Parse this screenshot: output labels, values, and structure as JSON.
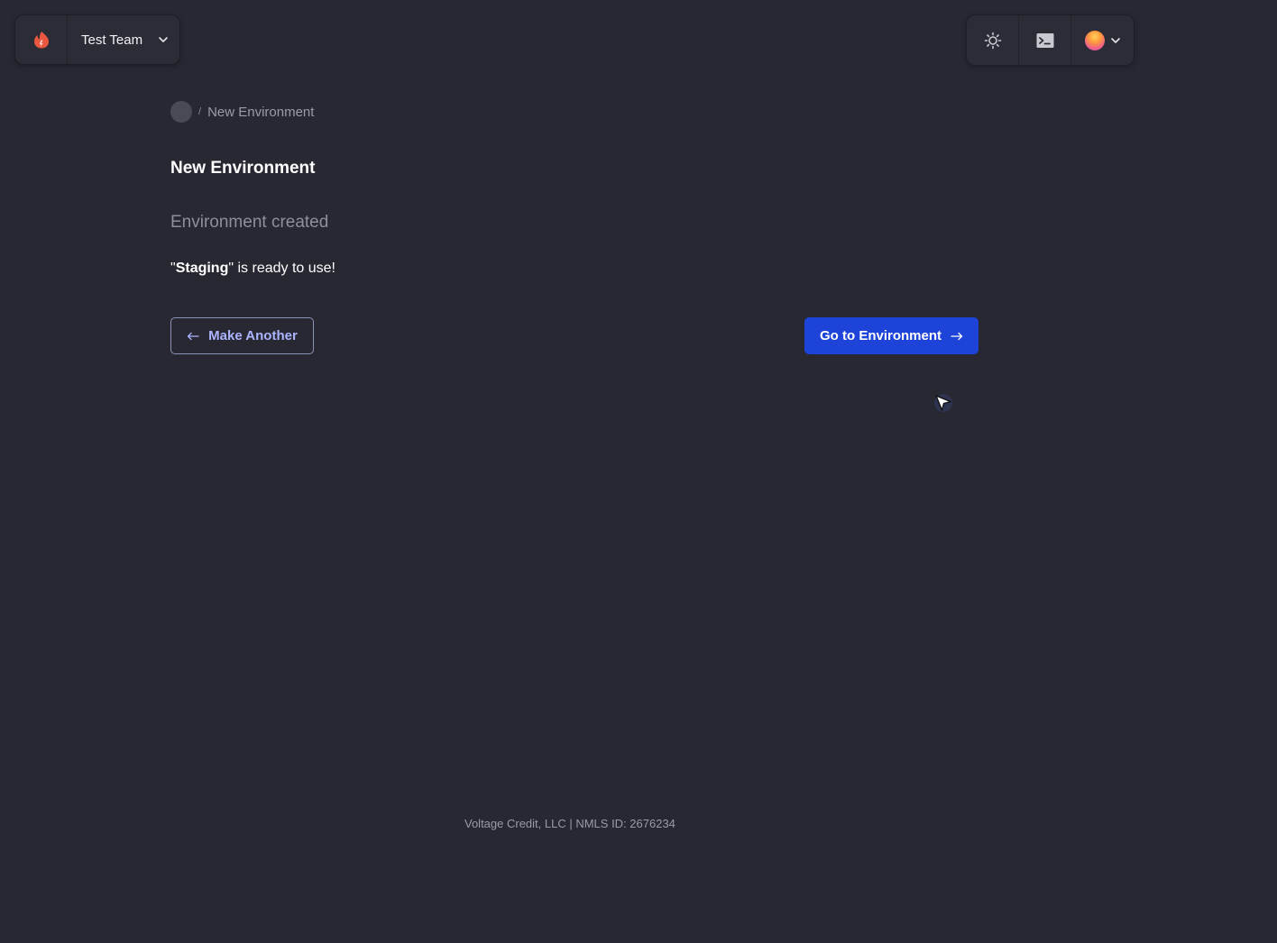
{
  "team_switcher": {
    "team_name": "Test Team",
    "logo_icon": "flame-logo-icon",
    "dropdown_icon": "chevron-down-icon"
  },
  "toolbar": {
    "theme_icon": "sun-icon",
    "terminal_icon": "terminal-icon",
    "user_icon": "avatar",
    "user_dropdown_icon": "chevron-down-icon"
  },
  "breadcrumb": {
    "separator": "/",
    "current": "New Environment"
  },
  "page": {
    "title": "New Environment",
    "status_heading": "Environment created",
    "message": {
      "quote_open": "\"",
      "name": "Staging",
      "suffix": "\" is ready to use!"
    }
  },
  "actions": {
    "make_another_label": "Make Another",
    "make_another_icon": "arrow-left-icon",
    "go_to_label": "Go to Environment",
    "go_to_icon": "arrow-right-icon"
  },
  "footer": {
    "text": "Voltage Credit, LLC | NMLS ID: 2676234"
  },
  "colors": {
    "background": "#282833",
    "primary_button": "#1d43d9",
    "secondary_text": "#aab4ff",
    "logo": "#e9573f"
  }
}
